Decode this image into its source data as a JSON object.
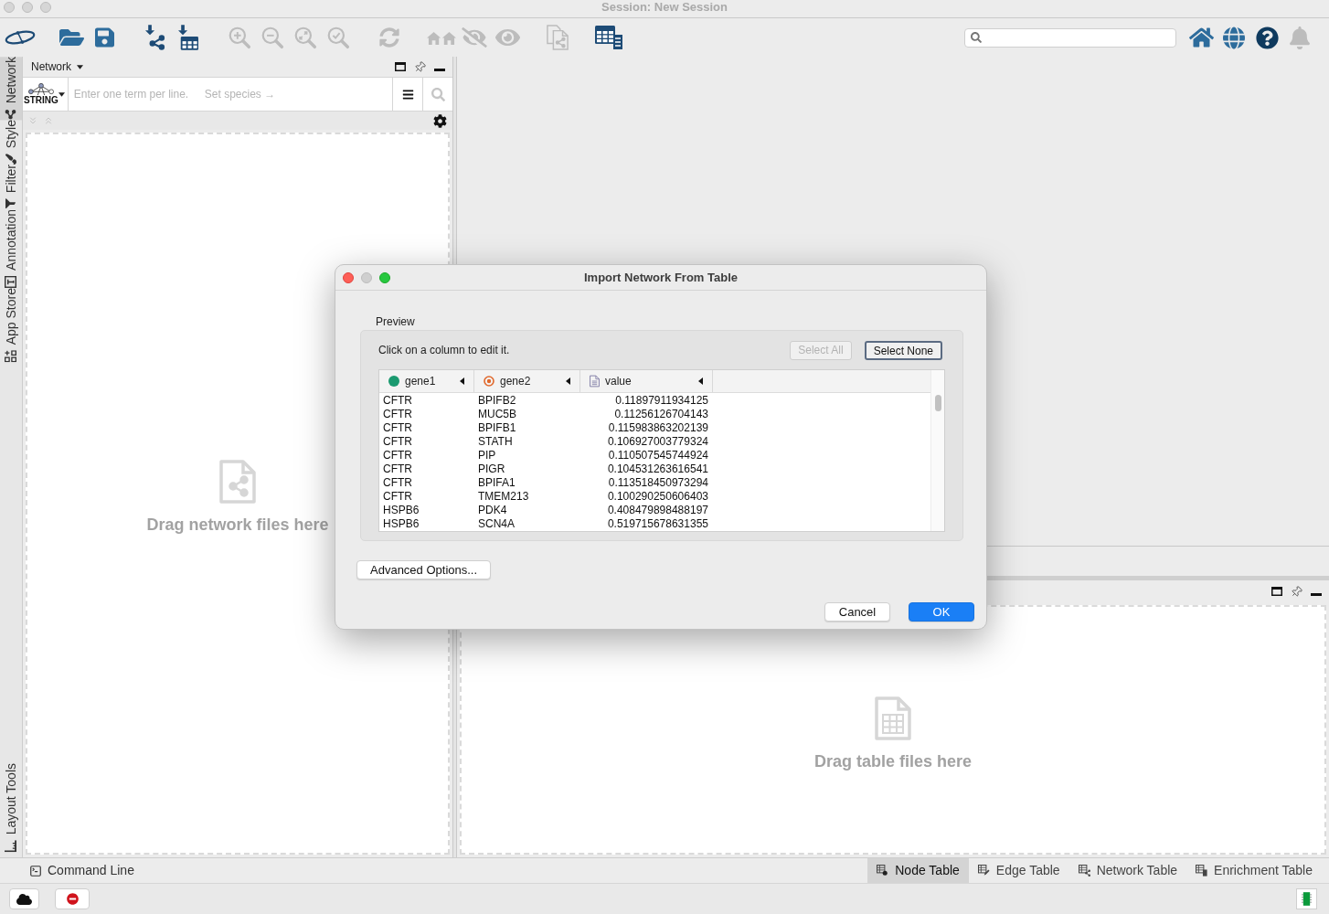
{
  "window": {
    "title": "Session: New Session"
  },
  "toolbar": {
    "tools": [
      {
        "disabled": false
      },
      {
        "disabled": false
      },
      {
        "disabled": false
      },
      {
        "disabled": false
      },
      {
        "disabled": false
      },
      {
        "disabled": true
      },
      {
        "disabled": true
      },
      {
        "disabled": true
      },
      {
        "disabled": true
      },
      {
        "disabled": true
      },
      {
        "disabled": true
      },
      {
        "disabled": true
      },
      {
        "disabled": true
      },
      {
        "disabled": true
      },
      {
        "disabled": false
      }
    ],
    "right_tools": [
      {
        "disabled": false
      },
      {
        "disabled": false
      },
      {
        "disabled": false
      },
      {
        "disabled": true
      }
    ]
  },
  "side_tabs": [
    {
      "label": "Network",
      "selected": true
    },
    {
      "label": "Style",
      "selected": false
    },
    {
      "label": "Filter",
      "selected": false
    },
    {
      "label": "Annotation",
      "selected": false
    },
    {
      "label": "App Store",
      "selected": false
    },
    {
      "label": "Layout Tools",
      "selected": false
    }
  ],
  "network_panel": {
    "title": "Network",
    "string_logo": "STRING",
    "search_placeholder": "Enter one term per line.",
    "species_link": "Set species →",
    "drop_hint": "Drag network files here"
  },
  "dialog": {
    "title": "Import Network From Table",
    "section": "Preview",
    "instruction": "Click on a column to edit it.",
    "select_buttons": [
      {
        "label": "Select All",
        "disabled": true,
        "focused": false
      },
      {
        "label": "Select None",
        "disabled": false,
        "focused": true
      }
    ],
    "columns": [
      {
        "name": "gene1",
        "kind": "source"
      },
      {
        "name": "gene2",
        "kind": "target"
      },
      {
        "name": "value",
        "kind": "attribute"
      }
    ],
    "rows": [
      [
        "CFTR",
        "BPIFB2",
        "0.11897911934125"
      ],
      [
        "CFTR",
        "MUC5B",
        "0.11256126704143"
      ],
      [
        "CFTR",
        "BPIFB1",
        "0.115983863202139"
      ],
      [
        "CFTR",
        "STATH",
        "0.106927003779324"
      ],
      [
        "CFTR",
        "PIP",
        "0.110507545744924"
      ],
      [
        "CFTR",
        "PIGR",
        "0.104531263616541"
      ],
      [
        "CFTR",
        "BPIFA1",
        "0.113518450973294"
      ],
      [
        "CFTR",
        "TMEM213",
        "0.100290250606403"
      ],
      [
        "HSPB6",
        "PDK4",
        "0.408479898488197"
      ],
      [
        "HSPB6",
        "SCN4A",
        "0.519715678631355"
      ]
    ],
    "advanced_button": "Advanced Options...",
    "buttons": [
      {
        "label": "Cancel",
        "kind": "secondary"
      },
      {
        "label": "OK",
        "kind": "primary"
      }
    ]
  },
  "table_panel": {
    "drop_hint": "Drag table files here"
  },
  "bottom_bar": {
    "command_line": "Command Line",
    "table_tabs": [
      {
        "label": "Node Table",
        "selected": true
      },
      {
        "label": "Edge Table",
        "selected": false
      },
      {
        "label": "Network Table",
        "selected": false
      },
      {
        "label": "Enrichment Table",
        "selected": false
      }
    ]
  }
}
